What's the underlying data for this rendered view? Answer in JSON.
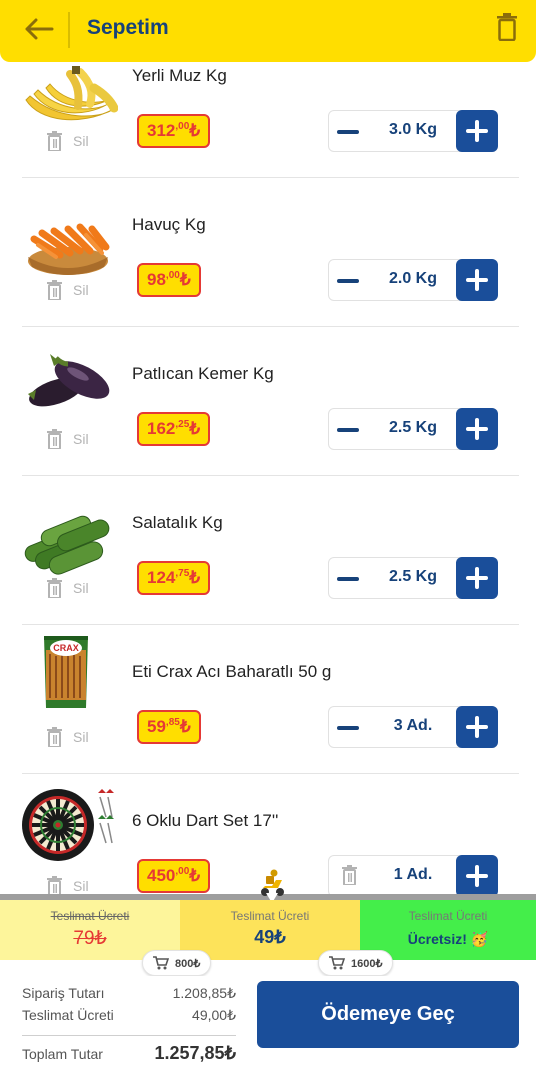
{
  "header": {
    "title": "Sepetim",
    "back_icon": "arrow-left-icon",
    "trash_icon": "trash-icon"
  },
  "delete_label": "Sil",
  "items": [
    {
      "name": "Yerli Muz Kg",
      "price_int": "312",
      "price_dec": ",00",
      "currency": "₺",
      "quantity": "3.0 Kg",
      "thumb": "banana"
    },
    {
      "name": "Havuç Kg",
      "price_int": "98",
      "price_dec": ",00",
      "currency": "₺",
      "quantity": "2.0 Kg",
      "thumb": "carrot"
    },
    {
      "name": "Patlıcan Kemer Kg",
      "price_int": "162",
      "price_dec": ",25",
      "currency": "₺",
      "quantity": "2.5 Kg",
      "thumb": "eggplant"
    },
    {
      "name": "Salatalık Kg",
      "price_int": "124",
      "price_dec": ",75",
      "currency": "₺",
      "quantity": "2.5 Kg",
      "thumb": "cucumber"
    },
    {
      "name": "Eti Crax Acı Baharatlı 50 g",
      "price_int": "59",
      "price_dec": ",85",
      "currency": "₺",
      "quantity": "3 Ad.",
      "thumb": "crax"
    },
    {
      "name": "6 Oklu Dart Set 17''",
      "price_int": "450",
      "price_dec": ",00",
      "currency": "₺",
      "quantity": "1 Ad.",
      "thumb": "dartboard"
    }
  ],
  "delivery": {
    "seg1_label": "Teslimat Ücreti",
    "seg1_value": "79₺",
    "seg2_label": "Teslimat Ücreti",
    "seg2_value": "49₺",
    "seg3_label": "Teslimat Ücreti",
    "seg3_value": "Ücretsiz! 🥳",
    "threshold1": "800₺",
    "threshold2": "1600₺"
  },
  "summary": {
    "order_label": "Sipariş Tutarı",
    "order_value": "1.208,85₺",
    "delivery_label": "Teslimat Ücreti",
    "delivery_value": "49,00₺",
    "total_label": "Toplam Tutar",
    "total_value": "1.257,85₺",
    "pay_label": "Ödemeye Geç"
  },
  "colors": {
    "header": "#ffde00",
    "brand_blue": "#1a4e9a",
    "price_red": "#e53935",
    "free_green": "#44ee4a"
  }
}
